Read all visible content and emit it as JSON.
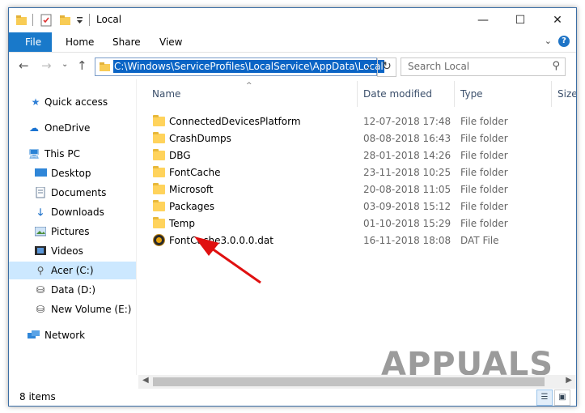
{
  "window": {
    "title": "Local",
    "controls": {
      "minimize": "—",
      "maximize": "☐",
      "close": "✕"
    }
  },
  "ribbon": {
    "tabs": [
      {
        "label": "File"
      },
      {
        "label": "Home"
      },
      {
        "label": "Share"
      },
      {
        "label": "View"
      }
    ]
  },
  "nav": {
    "address_path": "C:\\Windows\\ServiceProfiles\\LocalService\\AppData\\Local",
    "search_placeholder": "Search Local"
  },
  "sidebar": {
    "items": [
      {
        "label": "Quick access",
        "icon": "star-icon"
      },
      {
        "label": "OneDrive",
        "icon": "cloud-icon"
      },
      {
        "label": "This PC",
        "icon": "computer-icon"
      },
      {
        "label": "Desktop",
        "icon": "desktop-icon"
      },
      {
        "label": "Documents",
        "icon": "documents-icon"
      },
      {
        "label": "Downloads",
        "icon": "download-icon"
      },
      {
        "label": "Pictures",
        "icon": "pictures-icon"
      },
      {
        "label": "Videos",
        "icon": "videos-icon"
      },
      {
        "label": "Acer (C:)",
        "icon": "drive-icon",
        "selected": true
      },
      {
        "label": "Data (D:)",
        "icon": "drive-icon"
      },
      {
        "label": "New Volume (E:)",
        "icon": "drive-icon"
      },
      {
        "label": "Network",
        "icon": "network-icon"
      }
    ]
  },
  "columns": {
    "name": "Name",
    "date": "Date modified",
    "type": "Type",
    "size": "Size"
  },
  "files": [
    {
      "name": "ConnectedDevicesPlatform",
      "date": "12-07-2018 17:48",
      "type": "File folder",
      "icon": "folder-icon"
    },
    {
      "name": "CrashDumps",
      "date": "08-08-2018 16:43",
      "type": "File folder",
      "icon": "folder-icon"
    },
    {
      "name": "DBG",
      "date": "28-01-2018 14:26",
      "type": "File folder",
      "icon": "folder-icon"
    },
    {
      "name": "FontCache",
      "date": "23-11-2018 10:25",
      "type": "File folder",
      "icon": "folder-icon"
    },
    {
      "name": "Microsoft",
      "date": "20-08-2018 11:05",
      "type": "File folder",
      "icon": "folder-icon"
    },
    {
      "name": "Packages",
      "date": "03-09-2018 15:12",
      "type": "File folder",
      "icon": "folder-icon"
    },
    {
      "name": "Temp",
      "date": "01-10-2018 15:29",
      "type": "File folder",
      "icon": "folder-icon"
    },
    {
      "name": "FontCache3.0.0.0.dat",
      "date": "16-11-2018 18:08",
      "type": "DAT File",
      "icon": "dat-file-icon"
    }
  ],
  "status": {
    "item_count": "8 items"
  },
  "watermark": {
    "text": "APPUALS"
  },
  "colors": {
    "accent": "#1979ca",
    "selection": "#0a64c5",
    "nav_selected": "#cce8ff",
    "annotation_arrow": "#e01010"
  }
}
